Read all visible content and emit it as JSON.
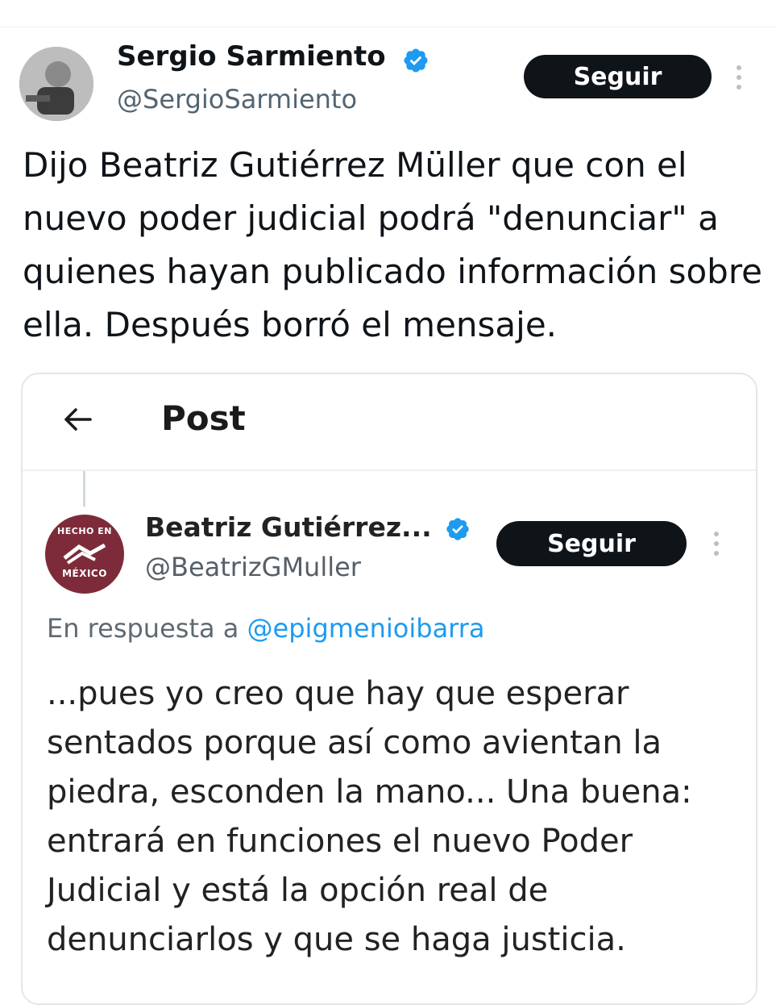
{
  "tweet": {
    "author_name": "Sergio Sarmiento",
    "author_handle": "@SergioSarmiento",
    "follow_label": "Seguir",
    "text": "Dijo Beatriz Gutiérrez Müller que con el nuevo poder judicial podrá \"denunciar\" a quienes hayan publicado información sobre ella. Después borró el mensaje."
  },
  "embedded_screenshot": {
    "header_title": "Post",
    "author_name": "Beatriz Gutiérrez...",
    "author_handle": "@BeatrizGMuller",
    "avatar_text_top": "HECHO EN",
    "avatar_text_bottom": "MÉXICO",
    "follow_label": "Seguir",
    "reply_prefix": "En respuesta a",
    "reply_mention": "@epigmenioibarra",
    "text": "...pues yo creo que hay que esperar sentados porque así como avientan la piedra, esconden la mano... Una buena: entrará en funciones el nuevo Poder Judicial y está la opción real de denunciarlos y que se haga justicia."
  },
  "colors": {
    "verified_badge": "#1d9bf0",
    "follow_button": "#0f1419",
    "mention_link": "#1d9bf0",
    "avatar2_background": "#7d2b3a"
  },
  "icons": [
    "verified-badge-icon",
    "more-options-icon",
    "back-arrow-icon"
  ]
}
